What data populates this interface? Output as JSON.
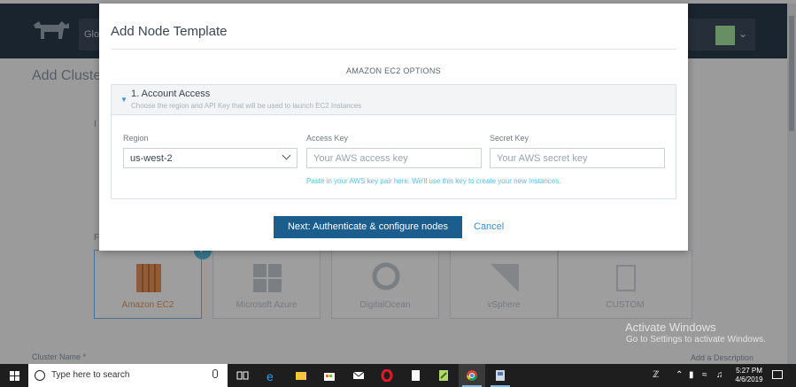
{
  "background": {
    "nav_label": "Glo",
    "page_title": "Add Cluster",
    "stub_i": "I",
    "stub_f": "F",
    "providers": [
      {
        "name": "Amazon EC2",
        "selected": true
      },
      {
        "name": "Microsoft Azure",
        "selected": false
      },
      {
        "name": "DigitalOcean",
        "selected": false
      },
      {
        "name": "vSphere",
        "selected": false
      },
      {
        "name": "CUSTOM",
        "selected": false
      }
    ],
    "cluster_name_label": "Cluster Name *",
    "add_description": "Add a Description"
  },
  "modal": {
    "title": "Add Node Template",
    "section_label": "AMAZON EC2 OPTIONS",
    "account_access": {
      "title": "1. Account Access",
      "description": "Choose the region and API Key that will be used to launch EC2 Instances"
    },
    "region": {
      "label": "Region",
      "value": "us-west-2"
    },
    "access_key": {
      "label": "Access Key",
      "placeholder": "Your AWS access key"
    },
    "secret_key": {
      "label": "Secret Key",
      "placeholder": "Your AWS secret key"
    },
    "help_text": "Paste in your AWS key pair here. We'll use this key to create your new Instances.",
    "next_button": "Next: Authenticate & configure nodes",
    "cancel_link": "Cancel"
  },
  "watermark": {
    "title": "Activate Windows",
    "subtitle": "Go to Settings to activate Windows."
  },
  "taskbar": {
    "search_placeholder": "Type here to search",
    "apps": [
      "task-view",
      "edge",
      "file-explorer",
      "store",
      "mail",
      "opera",
      "notepad",
      "notepad-plus",
      "chrome",
      "other"
    ],
    "time": "5:27 PM",
    "date": "4/6/2019"
  }
}
